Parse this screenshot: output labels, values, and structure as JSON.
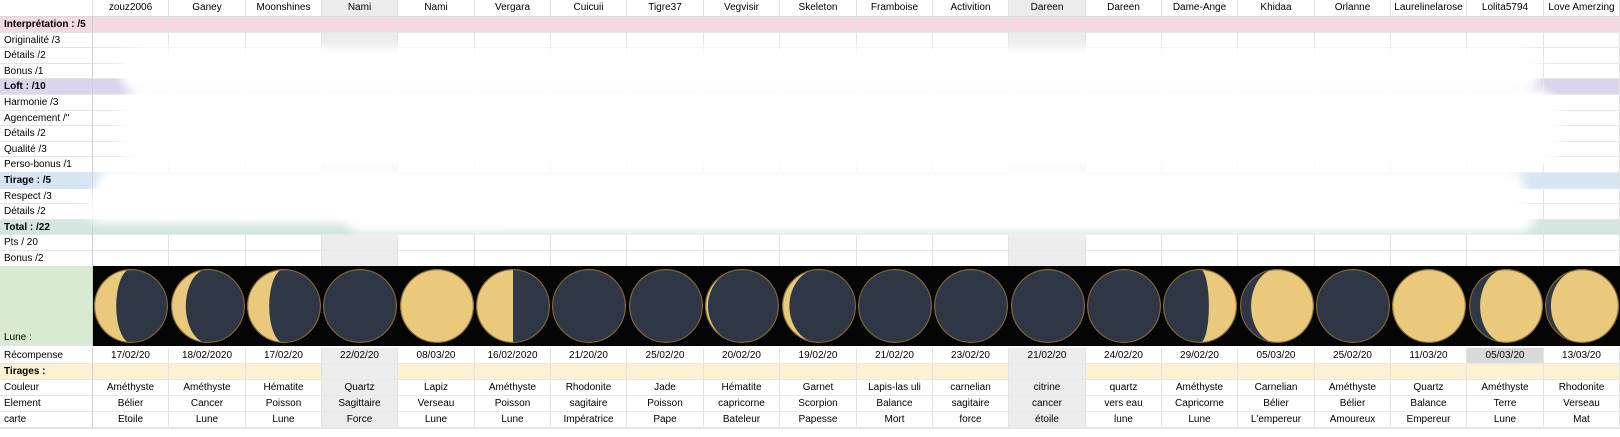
{
  "columns": [
    "zouz2006",
    "Ganey",
    "Moonshines",
    "Nami",
    "Nami",
    "Vergara",
    "Cuicuii",
    "Tigre37",
    "Vegvisir",
    "Skeleton",
    "Framboise",
    "Activition",
    "Dareen",
    "Dareen",
    "Dame-Ange",
    "Khidaa",
    "Orlanne",
    "Laurelinelarose",
    "Lolita5794",
    "Love Amerzing"
  ],
  "rows": [
    {
      "label": "Interprétation : /5",
      "bold": true,
      "bg": "#f4d8e2"
    },
    {
      "label": "Originalité /3"
    },
    {
      "label": "Détails /2"
    },
    {
      "label": "Bonus /1"
    },
    {
      "label": "Loft : /10",
      "bold": true,
      "bg": "#dcd3ec"
    },
    {
      "label": "Harmonie /3"
    },
    {
      "label": "Agencement /\""
    },
    {
      "label": "Détails /2"
    },
    {
      "label": "Qualité /3"
    },
    {
      "label": "Perso-bonus /1"
    },
    {
      "label": "Tirage : /5",
      "bold": true,
      "bg": "#d6e5f4"
    },
    {
      "label": "Respect /3"
    },
    {
      "label": "Détails /2"
    },
    {
      "label": "Total : /22",
      "bold": true,
      "bg": "#d3e6e2"
    },
    {
      "label": "Pts / 20"
    },
    {
      "label": "Bonus /2"
    }
  ],
  "lune": {
    "label": "Lune :",
    "label_bg": "#d9ead3",
    "phases": [
      {
        "lit": 0.3,
        "side": "left"
      },
      {
        "lit": 0.2,
        "side": "left"
      },
      {
        "lit": 0.3,
        "side": "left"
      },
      {
        "lit": 0.0,
        "side": "left"
      },
      {
        "lit": 1.0,
        "side": "left"
      },
      {
        "lit": 0.5,
        "side": "left"
      },
      {
        "lit": 0.0,
        "side": "left"
      },
      {
        "lit": 0.0,
        "side": "left"
      },
      {
        "lit": 0.04,
        "side": "left"
      },
      {
        "lit": 0.1,
        "side": "left"
      },
      {
        "lit": 0.0,
        "side": "left"
      },
      {
        "lit": 0.0,
        "side": "left"
      },
      {
        "lit": 0.0,
        "side": "left"
      },
      {
        "lit": 0.0,
        "side": "left"
      },
      {
        "lit": 0.38,
        "side": "right"
      },
      {
        "lit": 0.85,
        "side": "right"
      },
      {
        "lit": 0.0,
        "side": "left"
      },
      {
        "lit": 1.0,
        "side": "left"
      },
      {
        "lit": 0.85,
        "side": "right"
      },
      {
        "lit": 0.92,
        "side": "right"
      }
    ]
  },
  "recompense": {
    "label": "Récompense",
    "values": [
      "17/02/20",
      "18/02/2020",
      "17/02/20",
      "22/02/20",
      "08/03/20",
      "16/02/2020",
      "21/20/20",
      "25/02/20",
      "20/02/20",
      "19/02/20",
      "21/02/20",
      "23/02/20",
      "21/02/20",
      "24/02/20",
      "29/02/20",
      "05/03/20",
      "25/02/20",
      "11/03/20",
      "05/03/20",
      "13/03/20"
    ]
  },
  "tirages_label": "Tirages :",
  "tirages_bg": "#fdf1d3",
  "couleur": {
    "label": "Couleur",
    "values": [
      "Améthyste",
      "Améthyste",
      "Hématite",
      "Quartz",
      "Lapiz",
      "Améthyste",
      "Rhodonite",
      "Jade",
      "Hématite",
      "Garnet",
      "Lapis-las uli",
      "carnelian",
      "citrine",
      "quartz",
      "Améthyste",
      "Carnelian",
      "Améthyste",
      "Quartz",
      "Améthyste",
      "Rhodonite"
    ]
  },
  "element": {
    "label": "Element",
    "values": [
      "Bélier",
      "Cancer",
      "Poisson",
      "Sagittaire",
      "Verseau",
      "Poisson",
      "sagitaire",
      "Poisson",
      "capricorne",
      "Scorpion",
      "Balance",
      "sagitaire",
      "cancer",
      "vers eau",
      "Capricorne",
      "Bélier",
      "Bélier",
      "Balance",
      "Terre",
      "Verseau"
    ]
  },
  "carte": {
    "label": "carte",
    "values": [
      "Etoile",
      "Lune",
      "Lune",
      "Force",
      "Lune",
      "Lune",
      "Impératrice",
      "Pape",
      "Bateleur",
      "Papesse",
      "Mort",
      "force",
      "étoile",
      "lune",
      "Lune",
      "L'empereur",
      "Amoureux",
      "Empereur",
      "Lune",
      "Mat"
    ]
  },
  "colors": {
    "grid": "#e2e2e2",
    "grey_col": "#ececec",
    "moon_dark": "#2f3747",
    "moon_lit": "#e9c97c",
    "moon_bg": "#050505"
  }
}
